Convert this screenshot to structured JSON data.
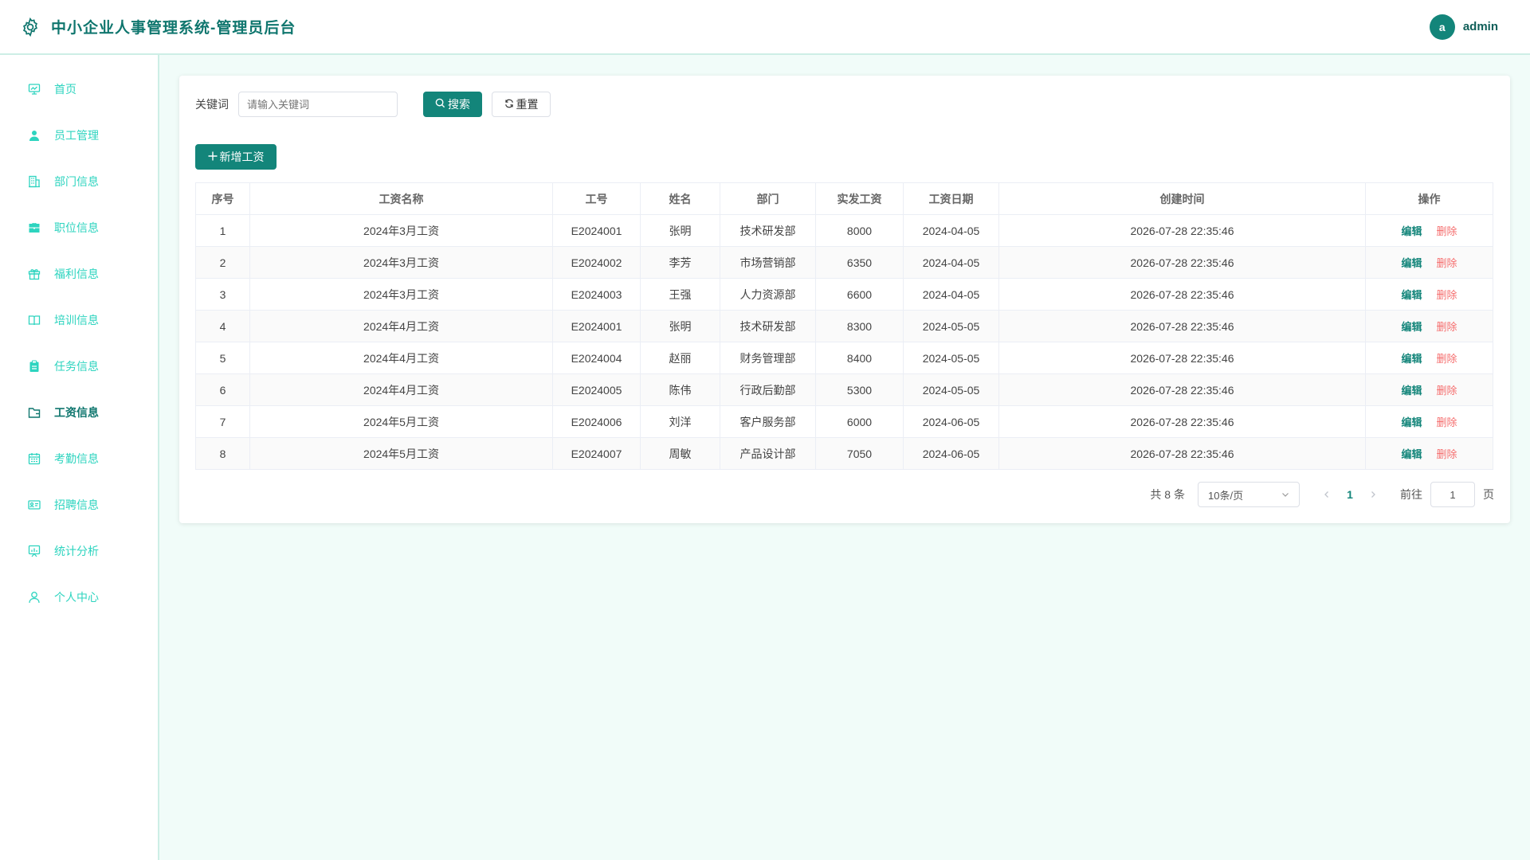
{
  "header": {
    "title": "中小企业人事管理系统-管理员后台",
    "avatar_letter": "a",
    "username": "admin"
  },
  "sidebar": {
    "items": [
      {
        "label": "首页",
        "icon": "dashboard-icon"
      },
      {
        "label": "员工管理",
        "icon": "user-icon"
      },
      {
        "label": "部门信息",
        "icon": "building-icon"
      },
      {
        "label": "职位信息",
        "icon": "briefcase-icon"
      },
      {
        "label": "福利信息",
        "icon": "gift-icon"
      },
      {
        "label": "培训信息",
        "icon": "book-icon"
      },
      {
        "label": "任务信息",
        "icon": "clipboard-icon"
      },
      {
        "label": "工资信息",
        "icon": "wallet-icon",
        "active": true
      },
      {
        "label": "考勤信息",
        "icon": "calendar-icon"
      },
      {
        "label": "招聘信息",
        "icon": "id-card-icon"
      },
      {
        "label": "统计分析",
        "icon": "chart-icon"
      },
      {
        "label": "个人中心",
        "icon": "person-icon"
      }
    ]
  },
  "search": {
    "label": "关键词",
    "placeholder": "请输入关键词",
    "search_label": "搜索",
    "reset_label": "重置"
  },
  "toolbar": {
    "add_label": "新增工资"
  },
  "table": {
    "columns": [
      "序号",
      "工资名称",
      "工号",
      "姓名",
      "部门",
      "实发工资",
      "工资日期",
      "创建时间",
      "操作"
    ],
    "rows": [
      [
        "1",
        "2024年3月工资",
        "E2024001",
        "张明",
        "技术研发部",
        "8000",
        "2024-04-05",
        "2026-07-28 22:35:46"
      ],
      [
        "2",
        "2024年3月工资",
        "E2024002",
        "李芳",
        "市场营销部",
        "6350",
        "2024-04-05",
        "2026-07-28 22:35:46"
      ],
      [
        "3",
        "2024年3月工资",
        "E2024003",
        "王强",
        "人力资源部",
        "6600",
        "2024-04-05",
        "2026-07-28 22:35:46"
      ],
      [
        "4",
        "2024年4月工资",
        "E2024001",
        "张明",
        "技术研发部",
        "8300",
        "2024-05-05",
        "2026-07-28 22:35:46"
      ],
      [
        "5",
        "2024年4月工资",
        "E2024004",
        "赵丽",
        "财务管理部",
        "8400",
        "2024-05-05",
        "2026-07-28 22:35:46"
      ],
      [
        "6",
        "2024年4月工资",
        "E2024005",
        "陈伟",
        "行政后勤部",
        "5300",
        "2024-05-05",
        "2026-07-28 22:35:46"
      ],
      [
        "7",
        "2024年5月工资",
        "E2024006",
        "刘洋",
        "客户服务部",
        "6000",
        "2024-06-05",
        "2026-07-28 22:35:46"
      ],
      [
        "8",
        "2024年5月工资",
        "E2024007",
        "周敏",
        "产品设计部",
        "7050",
        "2024-06-05",
        "2026-07-28 22:35:46"
      ]
    ],
    "edit_label": "编辑",
    "delete_label": "删除"
  },
  "pagination": {
    "total_text": "共 8 条",
    "page_size": "10条/页",
    "current_page": "1",
    "goto_label": "前往",
    "goto_value": "1",
    "page_suffix": "页"
  },
  "colors": {
    "primary": "#13857a",
    "sidebar_text": "#2dd4bf",
    "active_text": "#0f766e",
    "danger": "#f56c6c"
  }
}
